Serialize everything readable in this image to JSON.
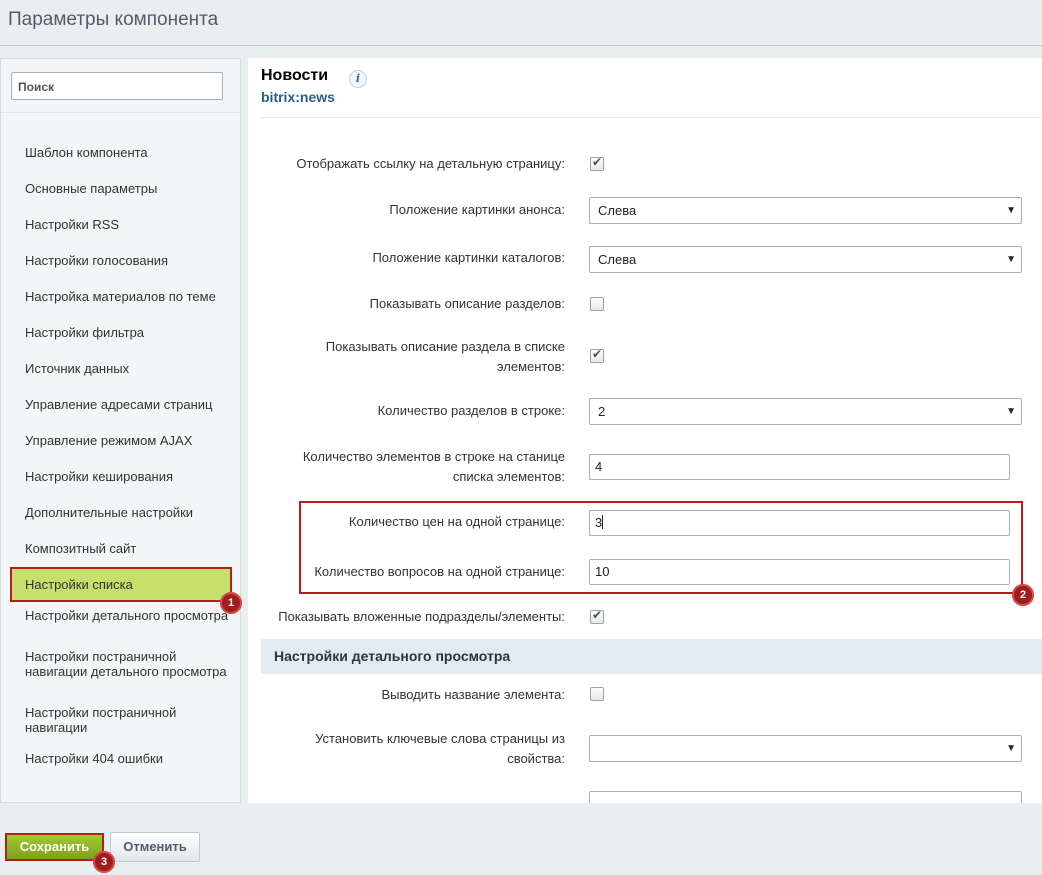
{
  "window": {
    "title": "Параметры компонента"
  },
  "sidebar": {
    "search_placeholder": "Поиск",
    "items": [
      {
        "label": "Шаблон компонента"
      },
      {
        "label": "Основные параметры"
      },
      {
        "label": "Настройки RSS"
      },
      {
        "label": "Настройки голосования"
      },
      {
        "label": "Настройка материалов по теме"
      },
      {
        "label": "Настройки фильтра"
      },
      {
        "label": "Источник данных"
      },
      {
        "label": "Управление адресами страниц"
      },
      {
        "label": "Управление режимом AJAX"
      },
      {
        "label": "Настройки кеширования"
      },
      {
        "label": "Дополнительные настройки"
      },
      {
        "label": "Композитный сайт"
      },
      {
        "label": "Настройки списка"
      },
      {
        "label": "Настройки детального просмотра"
      },
      {
        "label": "Настройки постраничной навигации детального просмотра"
      },
      {
        "label": "Настройки постраничной навигации"
      },
      {
        "label": "Настройки 404 ошибки"
      }
    ],
    "active_item": "Настройки списка"
  },
  "component": {
    "title": "Новости",
    "code": "bitrix:news",
    "info_icon": "i"
  },
  "fields": {
    "detail_link": {
      "label": "Отображать ссылку на детальную страницу:",
      "checked": true
    },
    "preview_picture_pos": {
      "label": "Положение картинки анонса:",
      "value": "Слева"
    },
    "catalog_picture_pos": {
      "label": "Положение картинки каталогов:",
      "value": "Слева"
    },
    "show_section_desc": {
      "label": "Показывать описание разделов:",
      "checked": false
    },
    "show_section_desc_list": {
      "label": "Показывать описание раздела в списке элементов:",
      "checked": true
    },
    "sections_per_row": {
      "label": "Количество разделов в строке:",
      "value": "2"
    },
    "elements_per_row": {
      "label": "Количество элементов в строке на станице списка элементов:",
      "value": "4"
    },
    "prices_per_page": {
      "label": "Количество цен на одной странице:",
      "value": "3"
    },
    "questions_per_page": {
      "label": "Количество вопросов на одной странице:",
      "value": "10"
    },
    "show_nested": {
      "label": "Показывать вложенные подразделы/элементы:",
      "checked": true
    }
  },
  "detail_section": {
    "title": "Настройки детального просмотра",
    "show_name": {
      "label": "Выводить название элемента:",
      "checked": false
    },
    "keywords_from_prop": {
      "label": "Установить ключевые слова страницы из свойства:",
      "value": ""
    }
  },
  "badges": {
    "one": "1",
    "two": "2",
    "three": "3"
  },
  "footer": {
    "save_label": "Сохранить",
    "cancel_label": "Отменить"
  },
  "colors": {
    "accent_green": "#a2c831",
    "highlight_red": "#b31f1f",
    "link_blue": "#2a5e8c"
  }
}
